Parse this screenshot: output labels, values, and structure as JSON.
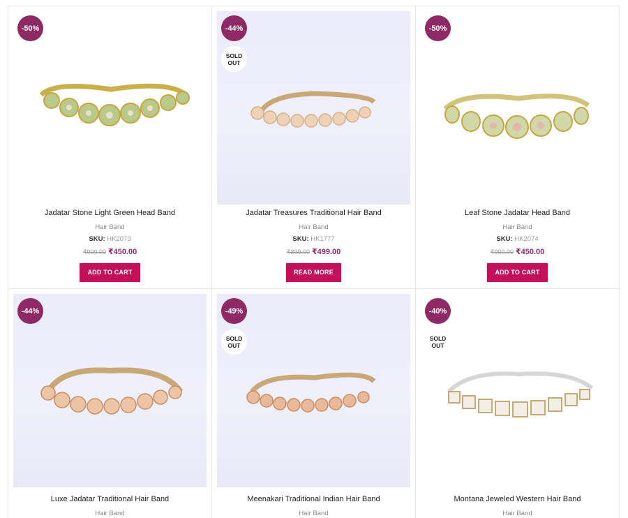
{
  "products": [
    {
      "discount": "-50%",
      "sold_out": false,
      "title": "Jadatar Stone Light Green Head Band",
      "category": "Hair Band",
      "sku_label": "SKU:",
      "sku": "HK2073",
      "old_price": "₹900.00",
      "new_price": "₹450.00",
      "button": "ADD TO CART"
    },
    {
      "discount": "-44%",
      "sold_out": true,
      "title": "Jadatar Treasures Traditional Hair Band",
      "category": "Hair Band",
      "sku_label": "SKU:",
      "sku": "HK1777",
      "old_price": "₹899.00",
      "new_price": "₹499.00",
      "button": "READ MORE"
    },
    {
      "discount": "-50%",
      "sold_out": false,
      "title": "Leaf Stone Jadatar Head Band",
      "category": "Hair Band",
      "sku_label": "SKU:",
      "sku": "HK2074",
      "old_price": "₹900.00",
      "new_price": "₹450.00",
      "button": "ADD TO CART"
    },
    {
      "discount": "-44%",
      "sold_out": false,
      "title": "Luxe Jadatar Traditional Hair Band",
      "category": "Hair Band"
    },
    {
      "discount": "-49%",
      "sold_out": true,
      "title": "Meenakari Traditional Indian Hair Band",
      "category": "Hair Band"
    },
    {
      "discount": "-40%",
      "sold_out": true,
      "title": "Montana Jeweled Western Hair Band",
      "category": "Hair Band"
    }
  ],
  "sold_out_label": [
    "SOLD",
    "OUT"
  ],
  "colors": {
    "badge": "#8d2a66",
    "button": "#c2105a",
    "price": "#8d2a66"
  }
}
